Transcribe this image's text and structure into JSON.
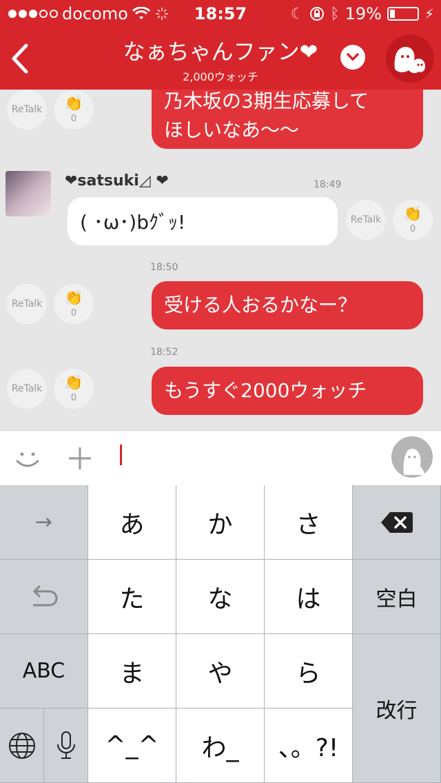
{
  "status": {
    "carrier": "docomo",
    "time": "18:57",
    "battery": "19%",
    "battery_level": 0.19,
    "icons": [
      "signal-dots",
      "wifi-icon",
      "activity-spinner-icon",
      "moon-icon",
      "rotation-lock-icon",
      "bluetooth-icon",
      "battery-icon",
      "charging-bolt-icon"
    ]
  },
  "nav": {
    "title": "なぁちゃんファン❤",
    "subtitle": "2,000ウォッチ"
  },
  "messages": {
    "m1": {
      "text": "乃木坂の3期生応募して\nほしいなあ〜〜",
      "retalk": "ReTalk",
      "claps": "0"
    },
    "m2": {
      "username": "❤satsuki◿ ❤",
      "time": "18:49",
      "text": "( ･ω･)bｸﾞｯ!",
      "retalk": "ReTalk",
      "claps": "0"
    },
    "m3": {
      "time": "18:50",
      "text": "受ける人おるかなー？",
      "retalk": "ReTalk",
      "claps": "0"
    },
    "m4": {
      "time": "18:52",
      "text": "もうすぐ2000ウォッチ",
      "retalk": "ReTalk",
      "claps": "0"
    }
  },
  "keyboard": {
    "rows": [
      [
        "→",
        "あ",
        "か",
        "さ",
        "⌫"
      ],
      [
        "↺",
        "た",
        "な",
        "は",
        "空白"
      ],
      [
        "ABC",
        "ま",
        "や",
        "ら",
        "改行"
      ],
      [
        "🌐",
        "🎤",
        "^_^",
        "わ_",
        "、。?!"
      ]
    ]
  }
}
